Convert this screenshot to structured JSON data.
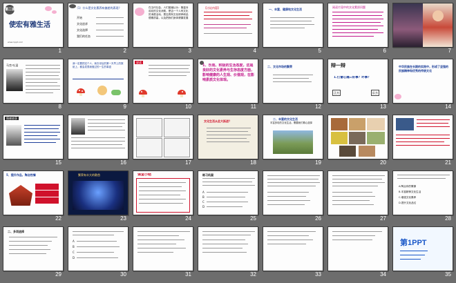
{
  "slides": [
    {
      "n": "1",
      "title": "使宏有雅生活",
      "chapter": "第二课",
      "footer": "www.1ppt.com"
    },
    {
      "n": "2",
      "heading": "（1）什么是文化素养有偏差的表现？",
      "items": [
        "开始",
        "文化追求",
        "文化选择",
        "我们的任务"
      ]
    },
    {
      "n": "3",
      "text": "在当代社会，人们普遍认为：衡量对欢欢的文化消费，是否一个人有文化的消费活动，是否具有文化修养和品德素质高，以及把我们身体健康发展"
    },
    {
      "n": "4",
      "heading": "【讨论内容】"
    },
    {
      "n": "5",
      "heading": "一、丰富、健康地文化生活"
    },
    {
      "n": "6",
      "text": "阅读片段中的文化素质问题"
    },
    {
      "n": "7"
    },
    {
      "n": "8",
      "caption": "马克·吐温"
    },
    {
      "n": "9",
      "text": "我一定要把这个人，我去世后的第一天早上的报纸上，都会发表我做过的一生的事迹"
    },
    {
      "n": "10",
      "badge": "说读"
    },
    {
      "n": "11",
      "text": "1、乐观、积极的生活态度，这是良好的文化素养与生存态度方面，影响健康的人生观、价值观，在影响素质文化体现。"
    },
    {
      "n": "12",
      "heading": "二、文化市场的繁荣"
    },
    {
      "n": "13",
      "heading": "辩一辩",
      "question": "1.打雷心痛=好事？坏事？",
      "left": "正方",
      "right": "反方"
    },
    {
      "n": "14",
      "text": "中华民族在长期的实践中，形成了坚强的民族精神和优秀的传统文化"
    },
    {
      "n": "15",
      "badge": "情感收获"
    },
    {
      "n": "16"
    },
    {
      "n": "17"
    },
    {
      "n": "18",
      "heading": "文化生活从此大跃进？"
    },
    {
      "n": "19",
      "heading": "二、丰富的文化生活",
      "sub": "丰富多彩的文化生活，需要我们精心选择"
    },
    {
      "n": "20"
    },
    {
      "n": "21"
    },
    {
      "n": "22",
      "heading": "5、提升作品，陶冶性情"
    },
    {
      "n": "23",
      "heading": "繁荣有丰大的歌首"
    },
    {
      "n": "24",
      "heading": "课堂小结"
    },
    {
      "n": "25",
      "heading": "练习巩固",
      "items": [
        "A",
        "B",
        "C",
        "D"
      ]
    },
    {
      "n": "26"
    },
    {
      "n": "27"
    },
    {
      "n": "28",
      "items": [
        "A.陶冶你的情操",
        "B.丰富精神文化生活",
        "C.增强文化素养",
        "D.提升文化品位"
      ]
    },
    {
      "n": "29",
      "heading": "二、多项选择"
    },
    {
      "n": "30",
      "items": [
        "A",
        "B",
        "C",
        "D"
      ]
    },
    {
      "n": "31"
    },
    {
      "n": "32"
    },
    {
      "n": "33"
    },
    {
      "n": "34"
    },
    {
      "n": "35",
      "logo": "第1PPT"
    }
  ]
}
